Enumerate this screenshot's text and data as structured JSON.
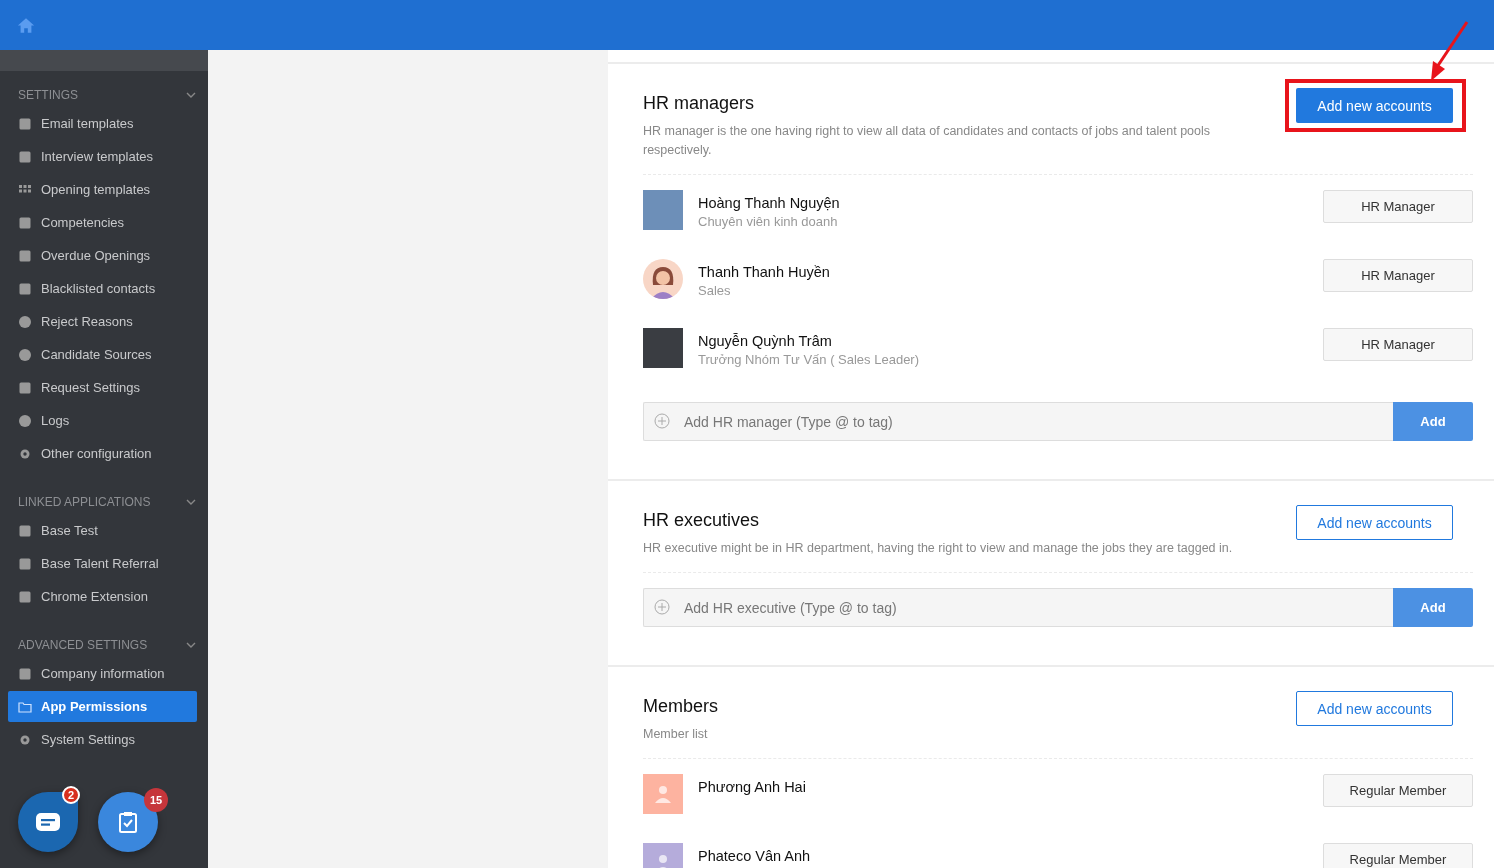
{
  "sidebar": {
    "groups": [
      {
        "title": "SETTINGS",
        "expanded": true,
        "items": [
          {
            "label": "Email templates",
            "selected": false
          },
          {
            "label": "Interview templates",
            "selected": false
          },
          {
            "label": "Opening templates",
            "selected": false
          },
          {
            "label": "Competencies",
            "selected": false
          },
          {
            "label": "Overdue Openings",
            "selected": false
          },
          {
            "label": "Blacklisted contacts",
            "selected": false
          },
          {
            "label": "Reject Reasons",
            "selected": false
          },
          {
            "label": "Candidate Sources",
            "selected": false
          },
          {
            "label": "Request Settings",
            "selected": false
          },
          {
            "label": "Logs",
            "selected": false
          },
          {
            "label": "Other configuration",
            "selected": false
          }
        ]
      },
      {
        "title": "LINKED APPLICATIONS",
        "expanded": true,
        "items": [
          {
            "label": "Base Test",
            "selected": false
          },
          {
            "label": "Base Talent Referral",
            "selected": false
          },
          {
            "label": "Chrome Extension",
            "selected": false
          }
        ]
      },
      {
        "title": "ADVANCED SETTINGS",
        "expanded": true,
        "items": [
          {
            "label": "Company information",
            "selected": false
          },
          {
            "label": "App Permissions",
            "selected": true
          },
          {
            "label": "System Settings",
            "selected": false
          }
        ]
      }
    ],
    "fab_badges": [
      "2",
      "15"
    ]
  },
  "sections": [
    {
      "title": "HR managers",
      "description": "HR manager is the one having right to view all data of candidates and contacts of jobs and talent pools respectively.",
      "add_button": {
        "label": "Add new accounts",
        "kind": "primary",
        "annotated": true
      },
      "people": [
        {
          "name": "Hoàng Thanh Nguyện",
          "subtitle": "Chuyên viên kinh doanh",
          "role": "HR Manager",
          "kind": "photo",
          "color": "#6d8fb8"
        },
        {
          "name": "Thanh Thanh Huyền",
          "subtitle": "Sales",
          "role": "HR Manager",
          "kind": "illustration",
          "color": "#f8d6c6"
        },
        {
          "name": "Nguyễn Quỳnh Trâm",
          "subtitle": "Trưởng Nhóm Tư Vấn ( Sales Leader)",
          "role": "HR Manager",
          "kind": "photo",
          "color": "#3a3d42"
        }
      ],
      "input": {
        "placeholder": "Add HR manager (Type @ to tag)",
        "button": "Add"
      }
    },
    {
      "title": "HR executives",
      "description": "HR executive might be in HR department, having the right to view and manage the jobs they are tagged in.",
      "add_button": {
        "label": "Add new accounts",
        "kind": "outline"
      },
      "input": {
        "placeholder": "Add HR executive (Type @ to tag)",
        "button": "Add"
      }
    },
    {
      "title": "Members",
      "description": "Member list",
      "add_button": {
        "label": "Add new accounts",
        "kind": "outline"
      },
      "people": [
        {
          "name": "Phương Anh Hai",
          "role": "Regular Member",
          "kind": "placeholder",
          "color": "#fdb3a0"
        },
        {
          "name": "Phateco Vân Anh",
          "role": "Regular Member",
          "kind": "placeholder",
          "color": "#b5acdb"
        }
      ]
    }
  ]
}
